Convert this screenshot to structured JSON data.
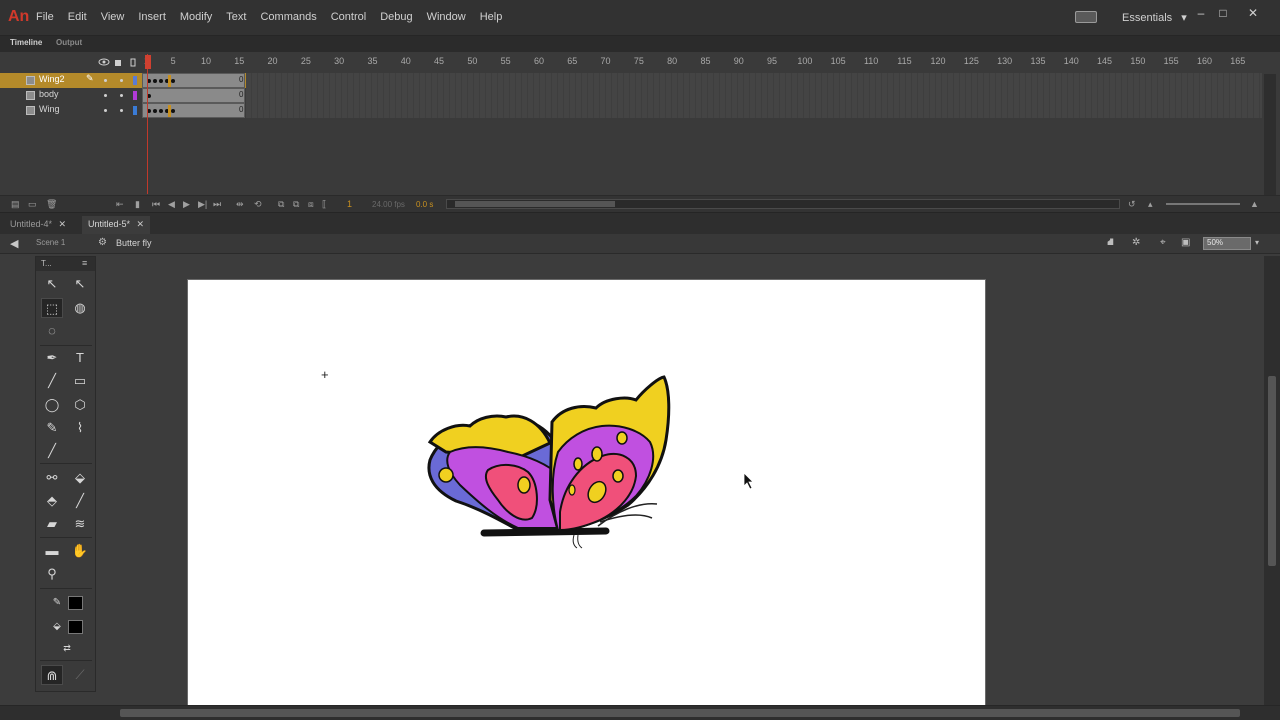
{
  "app": {
    "logo": "An"
  },
  "menu": {
    "items": [
      "File",
      "Edit",
      "View",
      "Insert",
      "Modify",
      "Text",
      "Commands",
      "Control",
      "Debug",
      "Window",
      "Help"
    ],
    "workspace": "Essentials",
    "workspace_arrow": "▾",
    "minimize": "–",
    "maximize": "□",
    "close": "✕"
  },
  "timeline": {
    "tabs": [
      "Timeline",
      "Output"
    ],
    "ruler": [
      "1",
      "5",
      "10",
      "15",
      "20",
      "25",
      "30",
      "35",
      "40",
      "45",
      "50",
      "55",
      "60",
      "65",
      "70",
      "75",
      "80",
      "85",
      "90",
      "95",
      "100",
      "105",
      "110",
      "115",
      "120",
      "125",
      "130",
      "135",
      "140",
      "145",
      "150",
      "155",
      "160",
      "165"
    ],
    "layers": [
      {
        "name": "Wing2",
        "color": "#5a7bd6",
        "selected": true,
        "end_marker": "0"
      },
      {
        "name": "body",
        "color": "#b23ad6",
        "selected": false,
        "end_marker": "0"
      },
      {
        "name": "Wing",
        "color": "#3a7bd6",
        "selected": false,
        "end_marker": "0"
      }
    ],
    "frame_number": "1",
    "fps": "24.00 fps",
    "time": "0.0 s"
  },
  "documents": {
    "tabs": [
      {
        "label": "Untitled-4*",
        "active": false
      },
      {
        "label": "Untitled-5*",
        "active": true
      }
    ],
    "close_glyph": "✕"
  },
  "edit_bar": {
    "scene": "Scene 1",
    "symbol": "Butter fly",
    "zoom": "50%"
  },
  "tools": {
    "title": "T...",
    "menu_glyph": "≡"
  },
  "colors": {
    "accent_layer": "#b48a2a",
    "playhead": "#c0392b",
    "stroke_swatch": "#000000",
    "fill_swatch": "#000000"
  }
}
